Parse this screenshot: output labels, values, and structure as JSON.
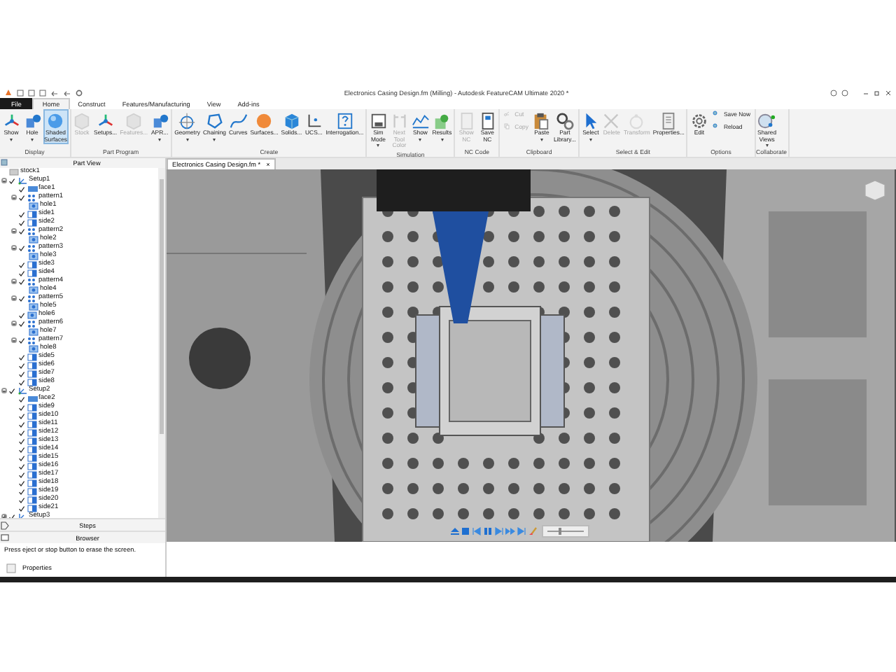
{
  "window": {
    "title": "Electronics Casing Design.fm (Milling) - Autodesk FeatureCAM Ultimate 2020 *"
  },
  "tabs": [
    {
      "label": "File",
      "selected": false,
      "kind": "file"
    },
    {
      "label": "Home",
      "selected": true,
      "kind": "tab"
    },
    {
      "label": "Construct",
      "selected": false,
      "kind": "tab"
    },
    {
      "label": "Features/Manufacturing",
      "selected": false,
      "kind": "tab"
    },
    {
      "label": "View",
      "selected": false,
      "kind": "tab"
    },
    {
      "label": "Add-ins",
      "selected": false,
      "kind": "tab"
    }
  ],
  "ribbon": {
    "groups": [
      {
        "label": "Display",
        "buttons": [
          {
            "label": "Show",
            "kind": "large",
            "disabled": false,
            "selected": false,
            "menu": true
          },
          {
            "label": "Hole",
            "kind": "large",
            "disabled": false,
            "selected": false,
            "menu": true
          },
          {
            "label": "Shaded Surfaces",
            "kind": "large",
            "disabled": false,
            "selected": true,
            "menu": false
          }
        ]
      },
      {
        "label": "Part Program",
        "buttons": [
          {
            "label": "Stock",
            "kind": "large",
            "disabled": true,
            "selected": false,
            "menu": false
          },
          {
            "label": "Setups...",
            "kind": "large",
            "disabled": false,
            "selected": false,
            "menu": false
          },
          {
            "label": "Features...",
            "kind": "large",
            "disabled": true,
            "selected": false,
            "menu": false
          },
          {
            "label": "APR...",
            "kind": "large",
            "disabled": false,
            "selected": false,
            "menu": true
          }
        ]
      },
      {
        "label": "Create",
        "buttons": [
          {
            "label": "Geometry",
            "kind": "large",
            "disabled": false,
            "selected": false,
            "menu": true
          },
          {
            "label": "Chaining",
            "kind": "large",
            "disabled": false,
            "selected": false,
            "menu": true
          },
          {
            "label": "Curves",
            "kind": "large",
            "disabled": false,
            "selected": false,
            "menu": false
          },
          {
            "label": "Surfaces...",
            "kind": "large",
            "disabled": false,
            "selected": false,
            "menu": false
          },
          {
            "label": "Solids...",
            "kind": "large",
            "disabled": false,
            "selected": false,
            "menu": false
          },
          {
            "label": "UCS...",
            "kind": "large",
            "disabled": false,
            "selected": false,
            "menu": false
          },
          {
            "label": "Interrogation...",
            "kind": "large",
            "disabled": false,
            "selected": false,
            "menu": false
          }
        ]
      },
      {
        "label": "Simulation",
        "buttons": [
          {
            "label": "Sim Mode",
            "kind": "large",
            "disabled": false,
            "selected": false,
            "menu": true
          },
          {
            "label": "Next Tool Color",
            "kind": "large",
            "disabled": true,
            "selected": false,
            "menu": false
          },
          {
            "label": "Show",
            "kind": "large",
            "disabled": false,
            "selected": false,
            "menu": true
          },
          {
            "label": "Results",
            "kind": "large",
            "disabled": false,
            "selected": false,
            "menu": true
          }
        ]
      },
      {
        "label": "NC Code",
        "buttons": [
          {
            "label": "Show NC",
            "kind": "large",
            "disabled": true,
            "selected": false,
            "menu": false
          },
          {
            "label": "Save NC",
            "kind": "large",
            "disabled": false,
            "selected": false,
            "menu": false
          }
        ]
      },
      {
        "label": "Clipboard",
        "buttons": [
          {
            "label": "Cut",
            "kind": "small",
            "disabled": true,
            "selected": false,
            "menu": false
          },
          {
            "label": "Copy",
            "kind": "small",
            "disabled": true,
            "selected": false,
            "menu": false
          },
          {
            "label": "Paste",
            "kind": "large",
            "disabled": false,
            "selected": false,
            "menu": true
          },
          {
            "label": "Part Library...",
            "kind": "large",
            "disabled": false,
            "selected": false,
            "menu": false
          }
        ]
      },
      {
        "label": "Select & Edit",
        "buttons": [
          {
            "label": "Select",
            "kind": "large",
            "disabled": false,
            "selected": false,
            "menu": true
          },
          {
            "label": "Delete",
            "kind": "large",
            "disabled": true,
            "selected": false,
            "menu": false
          },
          {
            "label": "Transform",
            "kind": "large",
            "disabled": true,
            "selected": false,
            "menu": false
          },
          {
            "label": "Properties...",
            "kind": "large",
            "disabled": false,
            "selected": false,
            "menu": false
          }
        ]
      },
      {
        "label": "Options",
        "buttons": [
          {
            "label": "Edit",
            "kind": "large",
            "disabled": false,
            "selected": false,
            "menu": false
          },
          {
            "label": "Save Now",
            "kind": "small",
            "disabled": false,
            "selected": false,
            "menu": false
          },
          {
            "label": "Reload",
            "kind": "small",
            "disabled": false,
            "selected": false,
            "menu": false
          }
        ]
      },
      {
        "label": "Collaborate",
        "buttons": [
          {
            "label": "Shared Views",
            "kind": "large",
            "disabled": false,
            "selected": false,
            "menu": true
          }
        ]
      }
    ]
  },
  "part_view": {
    "title": "Part View",
    "tree": [
      {
        "label": "stock1",
        "kind": "stock"
      },
      {
        "label": "Setup1",
        "kind": "setup",
        "checked": true,
        "expanded": true,
        "children": [
          {
            "label": "face1",
            "kind": "face",
            "checked": true
          },
          {
            "label": "pattern1",
            "kind": "pattern",
            "checked": true,
            "expanded": true,
            "children": [
              {
                "label": "hole1",
                "kind": "hole"
              }
            ]
          },
          {
            "label": "side1",
            "kind": "side",
            "checked": true
          },
          {
            "label": "side2",
            "kind": "side",
            "checked": true
          },
          {
            "label": "pattern2",
            "kind": "pattern",
            "checked": true,
            "expanded": true,
            "children": [
              {
                "label": "hole2",
                "kind": "hole"
              }
            ]
          },
          {
            "label": "pattern3",
            "kind": "pattern",
            "checked": true,
            "expanded": true,
            "children": [
              {
                "label": "hole3",
                "kind": "hole"
              }
            ]
          },
          {
            "label": "side3",
            "kind": "side",
            "checked": true
          },
          {
            "label": "side4",
            "kind": "side",
            "checked": true
          },
          {
            "label": "pattern4",
            "kind": "pattern",
            "checked": true,
            "expanded": true,
            "children": [
              {
                "label": "hole4",
                "kind": "hole"
              }
            ]
          },
          {
            "label": "pattern5",
            "kind": "pattern",
            "checked": true,
            "expanded": true,
            "children": [
              {
                "label": "hole5",
                "kind": "hole"
              }
            ]
          },
          {
            "label": "hole6",
            "kind": "hole",
            "checked": true
          },
          {
            "label": "pattern6",
            "kind": "pattern",
            "checked": true,
            "expanded": true,
            "children": [
              {
                "label": "hole7",
                "kind": "hole"
              }
            ]
          },
          {
            "label": "pattern7",
            "kind": "pattern",
            "checked": true,
            "expanded": true,
            "children": [
              {
                "label": "hole8",
                "kind": "hole"
              }
            ]
          },
          {
            "label": "side5",
            "kind": "side",
            "checked": true
          },
          {
            "label": "side6",
            "kind": "side",
            "checked": true
          },
          {
            "label": "side7",
            "kind": "side",
            "checked": true
          },
          {
            "label": "side8",
            "kind": "side",
            "checked": true
          }
        ]
      },
      {
        "label": "Setup2",
        "kind": "setup",
        "checked": true,
        "expanded": true,
        "children": [
          {
            "label": "face2",
            "kind": "face",
            "checked": true
          },
          {
            "label": "side9",
            "kind": "side",
            "checked": true
          },
          {
            "label": "side10",
            "kind": "side",
            "checked": true
          },
          {
            "label": "side11",
            "kind": "side",
            "checked": true
          },
          {
            "label": "side12",
            "kind": "side",
            "checked": true
          },
          {
            "label": "side13",
            "kind": "side",
            "checked": true
          },
          {
            "label": "side14",
            "kind": "side",
            "checked": true
          },
          {
            "label": "side15",
            "kind": "side",
            "checked": true
          },
          {
            "label": "side16",
            "kind": "side",
            "checked": true
          },
          {
            "label": "side17",
            "kind": "side",
            "checked": true
          },
          {
            "label": "side18",
            "kind": "side",
            "checked": true
          },
          {
            "label": "side19",
            "kind": "side",
            "checked": true
          },
          {
            "label": "side20",
            "kind": "side",
            "checked": true
          },
          {
            "label": "side21",
            "kind": "side",
            "checked": true
          }
        ]
      },
      {
        "label": "Setup3",
        "kind": "setup",
        "checked": true,
        "expanded": false
      }
    ]
  },
  "panels": [
    {
      "label": "Steps",
      "kind": "steps"
    },
    {
      "label": "Browser",
      "kind": "browser"
    }
  ],
  "status": "Press eject or stop button to erase the screen.",
  "properties": {
    "label": "Properties"
  },
  "document_tab": {
    "label": "Electronics Casing Design.fm *",
    "close": "×"
  },
  "playback": {
    "speed": {
      "level": 0.35
    }
  }
}
